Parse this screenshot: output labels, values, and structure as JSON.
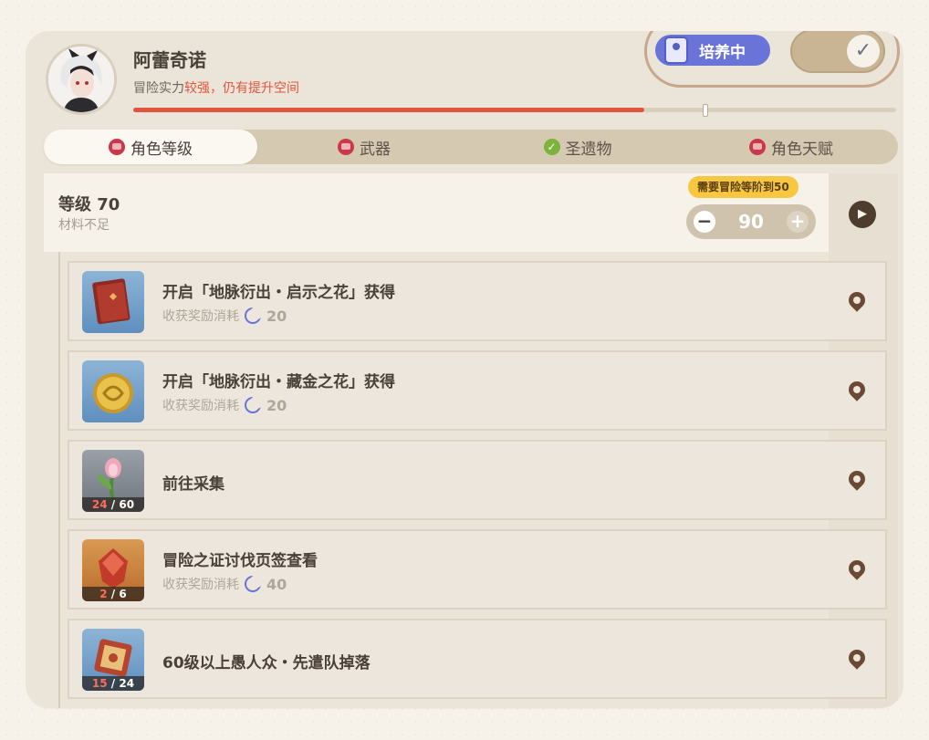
{
  "character": {
    "name": "阿蕾奇诺",
    "strength_prefix": "冒险实力",
    "strength_value": "较强，仍有提升空间",
    "progress": 0.67
  },
  "status": {
    "badge_label": "培养中",
    "toggle_checked": true
  },
  "tabs": [
    {
      "label": "角色等级",
      "icon": "red-gem-icon",
      "active": true
    },
    {
      "label": "武器",
      "icon": "red-gem-icon",
      "active": false
    },
    {
      "label": "圣遗物",
      "icon": "green-check-icon",
      "active": false
    },
    {
      "label": "角色天赋",
      "icon": "red-gem-icon",
      "active": false
    }
  ],
  "level": {
    "title": "等级 70",
    "subtitle": "材料不足",
    "requirement": "需要冒险等阶到50",
    "minus": "−",
    "target": "90",
    "plus": "+"
  },
  "items": [
    {
      "title": "开启「地脉衍出・启示之花」获得",
      "cost_label": "收获奖励消耗",
      "cost": "20",
      "thumb": "blue",
      "count_current": "",
      "count_total": ""
    },
    {
      "title": "开启「地脉衍出・藏金之花」获得",
      "cost_label": "收获奖励消耗",
      "cost": "20",
      "thumb": "blue",
      "count_current": "",
      "count_total": ""
    },
    {
      "title": "前往采集",
      "cost_label": "",
      "cost": "",
      "thumb": "gray",
      "count_current": "24",
      "count_total": " / 60"
    },
    {
      "title": "冒险之证讨伐页签查看",
      "cost_label": "收获奖励消耗",
      "cost": "40",
      "thumb": "orange",
      "count_current": "2",
      "count_total": " / 6"
    },
    {
      "title": "60级以上愚人众・先遣队掉落",
      "cost_label": "",
      "cost": "",
      "thumb": "blue",
      "count_current": "15",
      "count_total": " / 24"
    }
  ],
  "colors": {
    "accent_red": "#e2553c",
    "badge_blue": "#6a73d8",
    "requirement_yellow": "#f7c742"
  }
}
